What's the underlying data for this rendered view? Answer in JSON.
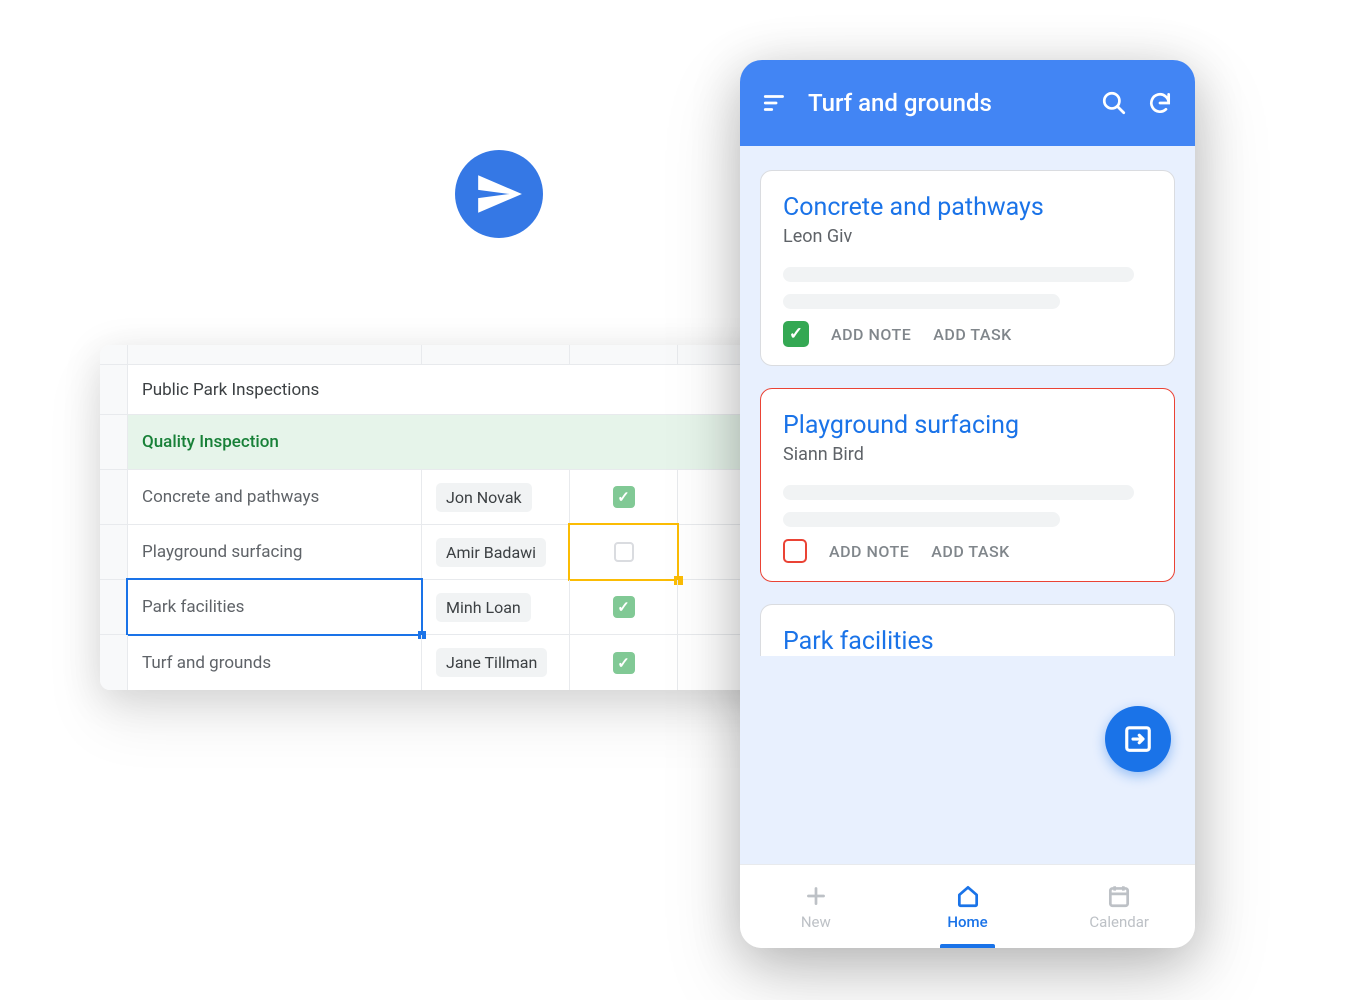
{
  "sheet": {
    "title": "Public Park Inspections",
    "section": "Quality Inspection",
    "rows": [
      {
        "item": "Concrete and pathways",
        "assignee": "Jon Novak",
        "checked": true
      },
      {
        "item": "Playground surfacing",
        "assignee": "Amir Badawi",
        "checked": false
      },
      {
        "item": "Park facilities",
        "assignee": "Minh Loan",
        "checked": true
      },
      {
        "item": "Turf and grounds",
        "assignee": "Jane Tillman",
        "checked": true
      }
    ]
  },
  "phone": {
    "header_title": "Turf and grounds",
    "cards": [
      {
        "title": "Concrete and pathways",
        "subtitle": "Leon Giv",
        "checked": true
      },
      {
        "title": "Playground surfacing",
        "subtitle": "Siann Bird",
        "checked": false
      },
      {
        "title": "Park facilities"
      }
    ],
    "add_note_label": "ADD NOTE",
    "add_task_label": "ADD TASK",
    "nav": {
      "new": "New",
      "home": "Home",
      "calendar": "Calendar"
    }
  }
}
